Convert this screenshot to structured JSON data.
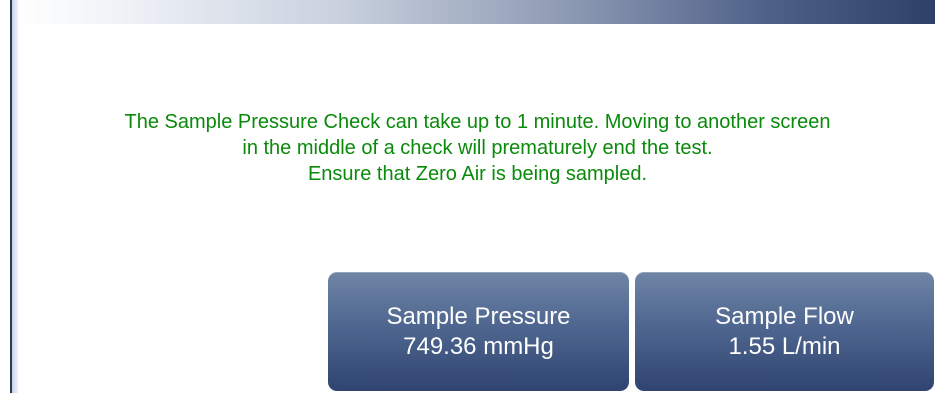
{
  "message": {
    "line1": "The Sample Pressure Check can take up to 1 minute. Moving to another screen",
    "line2": "in the middle of a check will prematurely end the test.",
    "line3": "Ensure that Zero Air is being sampled."
  },
  "buttons": {
    "sample_pressure": {
      "label": "Sample Pressure",
      "value": "749.36 mmHg"
    },
    "sample_flow": {
      "label": "Sample Flow",
      "value": "1.55 L/min"
    }
  },
  "colors": {
    "message_text": "#0a8a0a",
    "button_top": "#6f85a6",
    "button_bottom": "#2f4470",
    "title_bar_dark": "#2f4068"
  }
}
